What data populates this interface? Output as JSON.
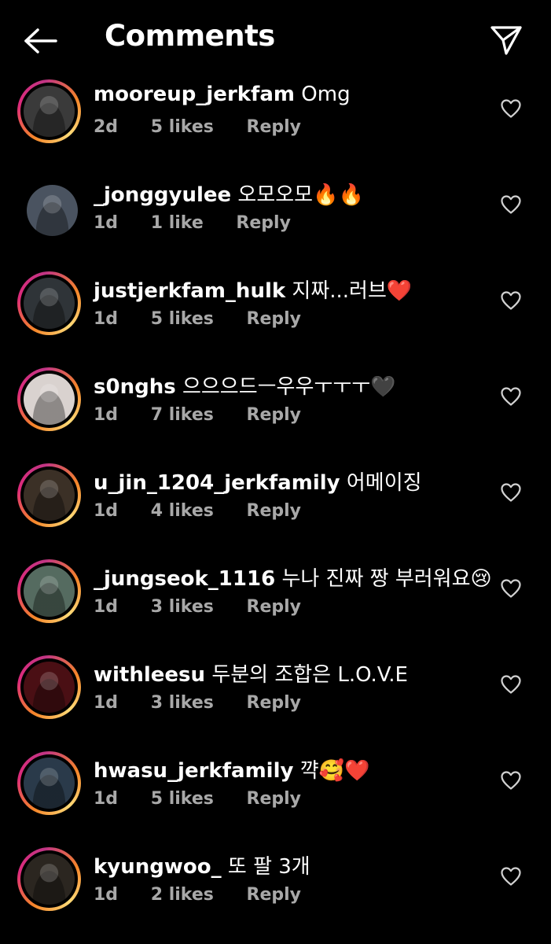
{
  "header": {
    "title": "Comments",
    "back_icon": "arrow-left-icon",
    "send_icon": "paper-plane-icon"
  },
  "colors": {
    "background": "#000000",
    "text": "#ffffff",
    "muted": "#a8a8a8"
  },
  "comments": [
    {
      "username": "mooreup_jerkfam",
      "text": "Omg",
      "time": "2d",
      "likes": "5 likes",
      "reply": "Reply",
      "story_ring": true,
      "avatar_color": "#3a3a3a"
    },
    {
      "username": "_jonggyulee",
      "text": "오모오모🔥🔥",
      "time": "1d",
      "likes": "1 like",
      "reply": "Reply",
      "story_ring": false,
      "avatar_color": "#4a5360"
    },
    {
      "username": "justjerkfam_hulk",
      "text": "지짜...러브❤️",
      "time": "1d",
      "likes": "5 likes",
      "reply": "Reply",
      "story_ring": true,
      "avatar_color": "#2f3438"
    },
    {
      "username": "s0nghs",
      "text": "으으으드ㅡ우우ㅜㅜㅜ🖤",
      "time": "1d",
      "likes": "7 likes",
      "reply": "Reply",
      "story_ring": true,
      "avatar_color": "#d9d2cf"
    },
    {
      "username": "u_jin_1204_jerkfamily",
      "text": "어메이징",
      "time": "1d",
      "likes": "4 likes",
      "reply": "Reply",
      "story_ring": true,
      "avatar_color": "#3b3026"
    },
    {
      "username": "_jungseok_1116",
      "text": "누나 진짜 짱 부러워요😢",
      "time": "1d",
      "likes": "3 likes",
      "reply": "Reply",
      "story_ring": true,
      "avatar_color": "#556b60"
    },
    {
      "username": "withleesu",
      "text": "두분의 조합은 L.O.V.E",
      "time": "1d",
      "likes": "3 likes",
      "reply": "Reply",
      "story_ring": true,
      "avatar_color": "#4a0f14"
    },
    {
      "username": "hwasu_jerkfamily",
      "text": "꺅🥰❤️",
      "time": "1d",
      "likes": "5 likes",
      "reply": "Reply",
      "story_ring": true,
      "avatar_color": "#2a3a4a"
    },
    {
      "username": "kyungwoo_",
      "text": "또 팔 3개",
      "time": "1d",
      "likes": "2 likes",
      "reply": "Reply",
      "story_ring": true,
      "avatar_color": "#2b2620"
    }
  ]
}
